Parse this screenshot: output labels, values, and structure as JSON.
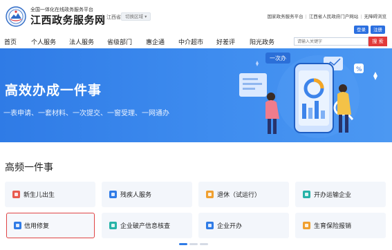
{
  "header": {
    "brand_subtitle": "全国一体化在线政务服务平台",
    "brand_title": "江西政务服务网",
    "region_label": "江西省",
    "region_switch": "切换区域",
    "region_switch_icon": "caret-down-icon",
    "top_links": [
      "国家政务服务平台",
      "江西省人民政府门户网站",
      "无障碍浏览"
    ],
    "login_label": "登录",
    "register_label": "注册"
  },
  "nav": {
    "items": [
      "首页",
      "个人服务",
      "法人服务",
      "省级部门",
      "惠企通",
      "中介超市",
      "好差评",
      "阳光政务"
    ],
    "search_placeholder": "请输入关键字",
    "search_button": "搜 索"
  },
  "banner": {
    "title": "高效办成一件事",
    "subtitle": "一表申请、一套材料、一次提交、一窗受理、一网通办",
    "art_tag": "一次办",
    "art_badge": "%"
  },
  "services": {
    "section_title": "高频一件事",
    "items": [
      {
        "label": "新生儿出生",
        "icon": "baby-icon",
        "color": "#e85a4f"
      },
      {
        "label": "残疾人服务",
        "icon": "wheelchair-icon",
        "color": "#2f7be6"
      },
      {
        "label": "退休（试运行）",
        "icon": "retire-icon",
        "color": "#f0a030"
      },
      {
        "label": "开办运输企业",
        "icon": "truck-icon",
        "color": "#27b3a8"
      },
      {
        "label": "信用修复",
        "icon": "credit-icon",
        "color": "#2f7be6"
      },
      {
        "label": "企业破产信息核查",
        "icon": "enterprise-icon",
        "color": "#27b3a8"
      },
      {
        "label": "企业开办",
        "icon": "building-icon",
        "color": "#2f7be6"
      },
      {
        "label": "生育保险报销",
        "icon": "insurance-icon",
        "color": "#f0a030"
      }
    ]
  },
  "colors": {
    "accent": "#2f7be6",
    "danger": "#e23a3a",
    "card_bg": "#f3f6fb"
  }
}
